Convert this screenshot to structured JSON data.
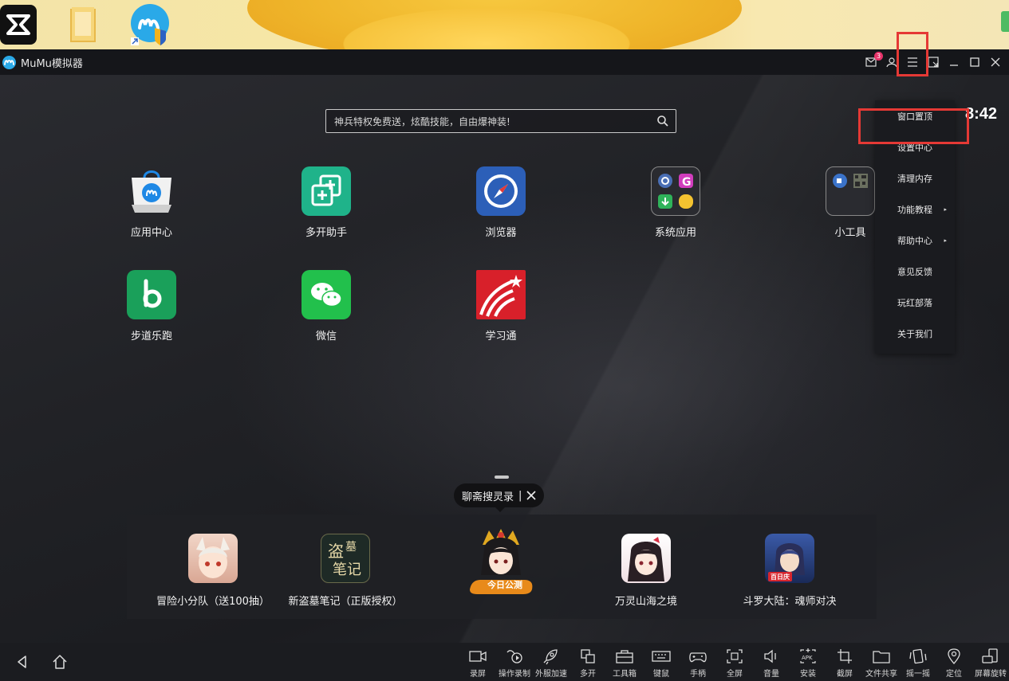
{
  "desktop": {
    "icons": [
      {
        "name": "capcut-icon"
      },
      {
        "name": "folder-icon"
      },
      {
        "name": "mumu-shortcut-icon"
      }
    ]
  },
  "window": {
    "title": "MuMu模拟器",
    "mail_badge": "3"
  },
  "status": {
    "clock": "8:42"
  },
  "search": {
    "placeholder": "神兵特权免费送，炫酷技能，自由爆神装!"
  },
  "apps_row1": [
    {
      "label": "应用中心"
    },
    {
      "label": "多开助手"
    },
    {
      "label": "浏览器"
    },
    {
      "label": "系统应用"
    },
    {
      "label": "小工具"
    }
  ],
  "apps_row2": [
    {
      "label": "步道乐跑"
    },
    {
      "label": "微信"
    },
    {
      "label": "学习通"
    }
  ],
  "tooltip": {
    "text": "聊斋搜灵录",
    "separator": "|"
  },
  "recommended": [
    {
      "label": "冒险小分队（送100抽）"
    },
    {
      "label": "新盗墓笔记（正版授权）"
    },
    {
      "label": "",
      "badge": "今日公测"
    },
    {
      "label": "万灵山海之境"
    },
    {
      "label": "斗罗大陆：魂师对决"
    }
  ],
  "menu": {
    "items": [
      {
        "label": "窗口置顶",
        "submenu": false
      },
      {
        "label": "设置中心",
        "submenu": false
      },
      {
        "label": "清理内存",
        "submenu": false
      },
      {
        "label": "功能教程",
        "submenu": true
      },
      {
        "label": "帮助中心",
        "submenu": true
      },
      {
        "label": "意见反馈",
        "submenu": false
      },
      {
        "label": "玩红部落",
        "submenu": false
      },
      {
        "label": "关于我们",
        "submenu": false
      }
    ],
    "submenu_arrow": "▸"
  },
  "toolbar": {
    "items": [
      {
        "label": "录屏"
      },
      {
        "label": "操作录制"
      },
      {
        "label": "外服加速"
      },
      {
        "label": "多开"
      },
      {
        "label": "工具箱"
      },
      {
        "label": "键鼠"
      },
      {
        "label": "手柄"
      },
      {
        "label": "全屏"
      },
      {
        "label": "音量"
      },
      {
        "label": "安装"
      },
      {
        "label": "截屏"
      },
      {
        "label": "文件共享"
      },
      {
        "label": "摇一摇"
      },
      {
        "label": "定位"
      },
      {
        "label": "屏幕旋转"
      }
    ]
  },
  "colors": {
    "highlight": "#e53935",
    "badge": "#e7336a",
    "accent": "#2aa9e8"
  }
}
